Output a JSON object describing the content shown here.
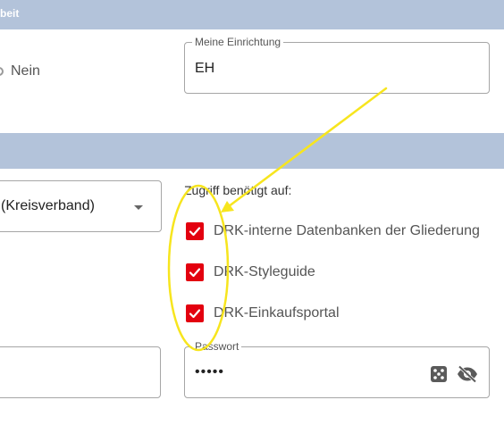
{
  "sections": {
    "top_title": "beit",
    "bottom_title": ""
  },
  "radio": {
    "label": "Nein"
  },
  "einrichtung": {
    "label": "Meine Einrichtung",
    "value": "EH"
  },
  "select": {
    "value": "(Kreisverband)"
  },
  "access": {
    "title": "Zugriff benötigt auf:",
    "items": [
      {
        "label": "DRK-interne Datenbanken der Gliederung",
        "checked": true
      },
      {
        "label": "DRK-Styleguide",
        "checked": true
      },
      {
        "label": "DRK-Einkaufsportal",
        "checked": true
      }
    ]
  },
  "password": {
    "label": "Passwort",
    "value": "•••••"
  },
  "icons": {
    "dice": "dice-icon",
    "visibility": "eye-off-icon",
    "dropdown": "chevron-down-icon",
    "check": "check-icon"
  },
  "colors": {
    "section_bar": "#b3c3da",
    "checkbox": "#e3000f",
    "annotation": "#f7e51e"
  }
}
